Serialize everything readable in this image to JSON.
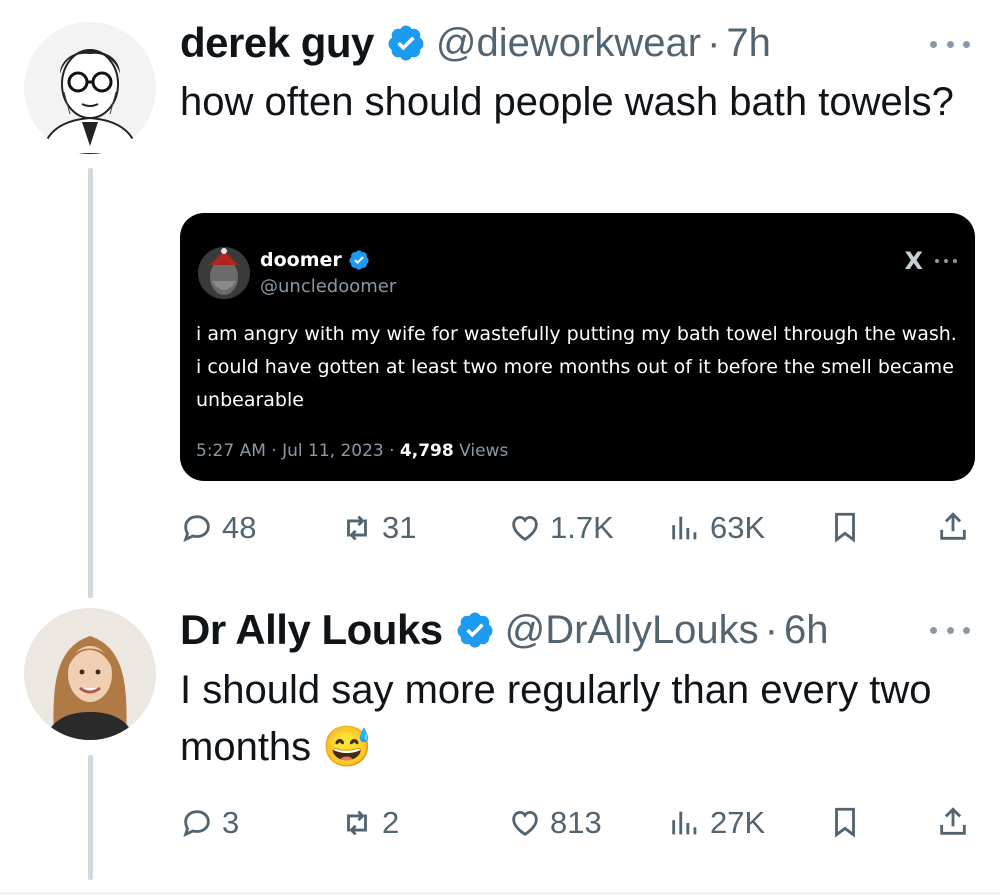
{
  "tweets": [
    {
      "author_name": "derek guy",
      "handle": "@dieworkwear",
      "separator": "·",
      "time": "7h",
      "text": "how often should people wash bath towels?",
      "quoted": {
        "author_name": "doomer",
        "handle": "@uncledoomer",
        "text": "i am angry with my wife for wastefully putting my bath towel through the wash. i could have gotten at least two more months out of it before the smell became unbearable",
        "meta_time": "5:27 AM · Jul 11, 2023 · ",
        "meta_views_count": "4,798",
        "meta_views_label": " Views",
        "x_logo": "X"
      },
      "stats": {
        "replies": "48",
        "reposts": "31",
        "likes": "1.7K",
        "views": "63K"
      }
    },
    {
      "author_name": "Dr Ally Louks",
      "handle": "@DrAllyLouks",
      "separator": "·",
      "time": "6h",
      "text": "I should say more regularly than every two months 😅",
      "stats": {
        "replies": "3",
        "reposts": "2",
        "likes": "813",
        "views": "27K"
      }
    }
  ],
  "colors": {
    "accent": "#1d9bf0",
    "secondary_text": "#536471",
    "card_bg": "#000000",
    "thread_line": "#cfd9de"
  },
  "icons": [
    "verified-badge-icon",
    "more-icon",
    "reply-icon",
    "repost-icon",
    "like-icon",
    "views-icon",
    "bookmark-icon",
    "share-icon"
  ]
}
